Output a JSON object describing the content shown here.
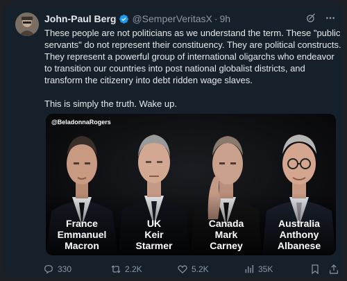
{
  "post": {
    "author_name": "John-Paul Berg",
    "handle": "@SemperVeritasX",
    "separator": "·",
    "time": "9h",
    "paragraphs": [
      "These people are not politicians as we understand the term. These \"public servants\" do not represent their constituency. They are political constructs. They represent a powerful group of international oligarchs who endeavor to transition our countries into post national globalist districts, and transform the citizenry into debt ridden wage slaves.",
      "This is simply the truth. Wake up."
    ]
  },
  "media": {
    "watermark": "@BeladonnaRogers",
    "leaders": [
      {
        "country": "France",
        "first": "Emmanuel",
        "last": "Macron"
      },
      {
        "country": "UK",
        "first": "Keir",
        "last": "Starmer"
      },
      {
        "country": "Canada",
        "first": "Mark",
        "last": "Carney"
      },
      {
        "country": "Australia",
        "first": "Anthony",
        "last": "Albanese"
      }
    ]
  },
  "actions": {
    "replies": "330",
    "reposts": "2.2K",
    "likes": "5.2K",
    "views": "35K"
  },
  "icons": [
    "verified-badge-icon",
    "grok-icon",
    "more-icon",
    "reply-icon",
    "repost-icon",
    "like-icon",
    "views-icon",
    "bookmark-icon",
    "share-icon"
  ],
  "colors": {
    "background": "#15202b",
    "text": "#e7e9ea",
    "secondary": "#8b98a5",
    "verified": "#1d9bf0"
  }
}
